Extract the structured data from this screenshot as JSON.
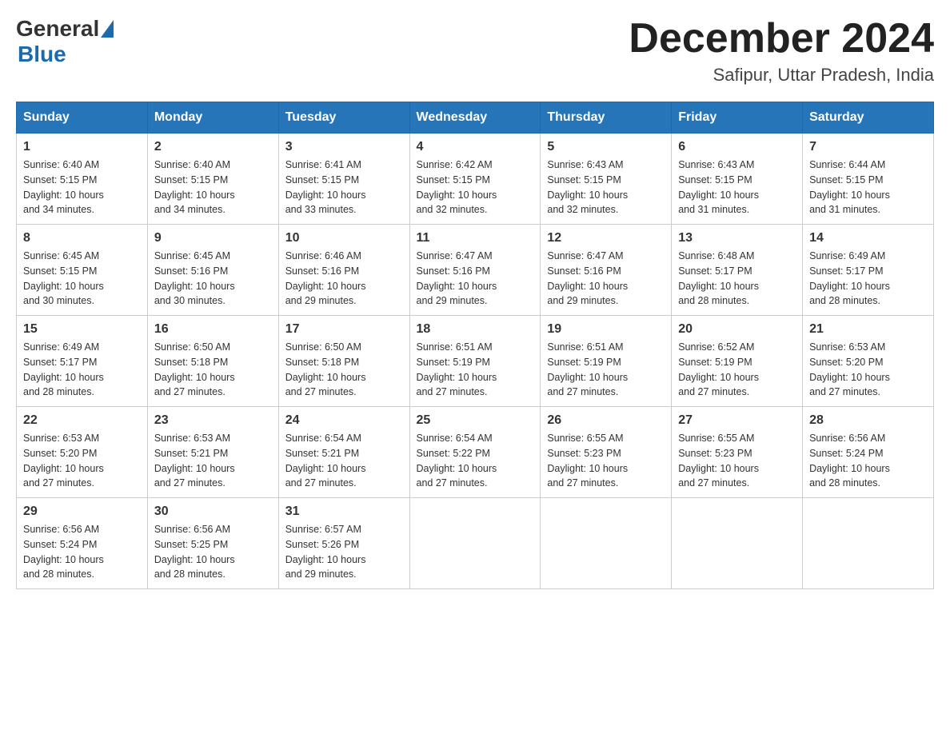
{
  "header": {
    "logo_general": "General",
    "logo_blue": "Blue",
    "month_title": "December 2024",
    "subtitle": "Safipur, Uttar Pradesh, India"
  },
  "columns": [
    "Sunday",
    "Monday",
    "Tuesday",
    "Wednesday",
    "Thursday",
    "Friday",
    "Saturday"
  ],
  "weeks": [
    [
      {
        "day": "1",
        "sunrise": "6:40 AM",
        "sunset": "5:15 PM",
        "daylight": "10 hours and 34 minutes."
      },
      {
        "day": "2",
        "sunrise": "6:40 AM",
        "sunset": "5:15 PM",
        "daylight": "10 hours and 34 minutes."
      },
      {
        "day": "3",
        "sunrise": "6:41 AM",
        "sunset": "5:15 PM",
        "daylight": "10 hours and 33 minutes."
      },
      {
        "day": "4",
        "sunrise": "6:42 AM",
        "sunset": "5:15 PM",
        "daylight": "10 hours and 32 minutes."
      },
      {
        "day": "5",
        "sunrise": "6:43 AM",
        "sunset": "5:15 PM",
        "daylight": "10 hours and 32 minutes."
      },
      {
        "day": "6",
        "sunrise": "6:43 AM",
        "sunset": "5:15 PM",
        "daylight": "10 hours and 31 minutes."
      },
      {
        "day": "7",
        "sunrise": "6:44 AM",
        "sunset": "5:15 PM",
        "daylight": "10 hours and 31 minutes."
      }
    ],
    [
      {
        "day": "8",
        "sunrise": "6:45 AM",
        "sunset": "5:15 PM",
        "daylight": "10 hours and 30 minutes."
      },
      {
        "day": "9",
        "sunrise": "6:45 AM",
        "sunset": "5:16 PM",
        "daylight": "10 hours and 30 minutes."
      },
      {
        "day": "10",
        "sunrise": "6:46 AM",
        "sunset": "5:16 PM",
        "daylight": "10 hours and 29 minutes."
      },
      {
        "day": "11",
        "sunrise": "6:47 AM",
        "sunset": "5:16 PM",
        "daylight": "10 hours and 29 minutes."
      },
      {
        "day": "12",
        "sunrise": "6:47 AM",
        "sunset": "5:16 PM",
        "daylight": "10 hours and 29 minutes."
      },
      {
        "day": "13",
        "sunrise": "6:48 AM",
        "sunset": "5:17 PM",
        "daylight": "10 hours and 28 minutes."
      },
      {
        "day": "14",
        "sunrise": "6:49 AM",
        "sunset": "5:17 PM",
        "daylight": "10 hours and 28 minutes."
      }
    ],
    [
      {
        "day": "15",
        "sunrise": "6:49 AM",
        "sunset": "5:17 PM",
        "daylight": "10 hours and 28 minutes."
      },
      {
        "day": "16",
        "sunrise": "6:50 AM",
        "sunset": "5:18 PM",
        "daylight": "10 hours and 27 minutes."
      },
      {
        "day": "17",
        "sunrise": "6:50 AM",
        "sunset": "5:18 PM",
        "daylight": "10 hours and 27 minutes."
      },
      {
        "day": "18",
        "sunrise": "6:51 AM",
        "sunset": "5:19 PM",
        "daylight": "10 hours and 27 minutes."
      },
      {
        "day": "19",
        "sunrise": "6:51 AM",
        "sunset": "5:19 PM",
        "daylight": "10 hours and 27 minutes."
      },
      {
        "day": "20",
        "sunrise": "6:52 AM",
        "sunset": "5:19 PM",
        "daylight": "10 hours and 27 minutes."
      },
      {
        "day": "21",
        "sunrise": "6:53 AM",
        "sunset": "5:20 PM",
        "daylight": "10 hours and 27 minutes."
      }
    ],
    [
      {
        "day": "22",
        "sunrise": "6:53 AM",
        "sunset": "5:20 PM",
        "daylight": "10 hours and 27 minutes."
      },
      {
        "day": "23",
        "sunrise": "6:53 AM",
        "sunset": "5:21 PM",
        "daylight": "10 hours and 27 minutes."
      },
      {
        "day": "24",
        "sunrise": "6:54 AM",
        "sunset": "5:21 PM",
        "daylight": "10 hours and 27 minutes."
      },
      {
        "day": "25",
        "sunrise": "6:54 AM",
        "sunset": "5:22 PM",
        "daylight": "10 hours and 27 minutes."
      },
      {
        "day": "26",
        "sunrise": "6:55 AM",
        "sunset": "5:23 PM",
        "daylight": "10 hours and 27 minutes."
      },
      {
        "day": "27",
        "sunrise": "6:55 AM",
        "sunset": "5:23 PM",
        "daylight": "10 hours and 27 minutes."
      },
      {
        "day": "28",
        "sunrise": "6:56 AM",
        "sunset": "5:24 PM",
        "daylight": "10 hours and 28 minutes."
      }
    ],
    [
      {
        "day": "29",
        "sunrise": "6:56 AM",
        "sunset": "5:24 PM",
        "daylight": "10 hours and 28 minutes."
      },
      {
        "day": "30",
        "sunrise": "6:56 AM",
        "sunset": "5:25 PM",
        "daylight": "10 hours and 28 minutes."
      },
      {
        "day": "31",
        "sunrise": "6:57 AM",
        "sunset": "5:26 PM",
        "daylight": "10 hours and 29 minutes."
      },
      null,
      null,
      null,
      null
    ]
  ],
  "labels": {
    "sunrise": "Sunrise:",
    "sunset": "Sunset:",
    "daylight": "Daylight:"
  }
}
